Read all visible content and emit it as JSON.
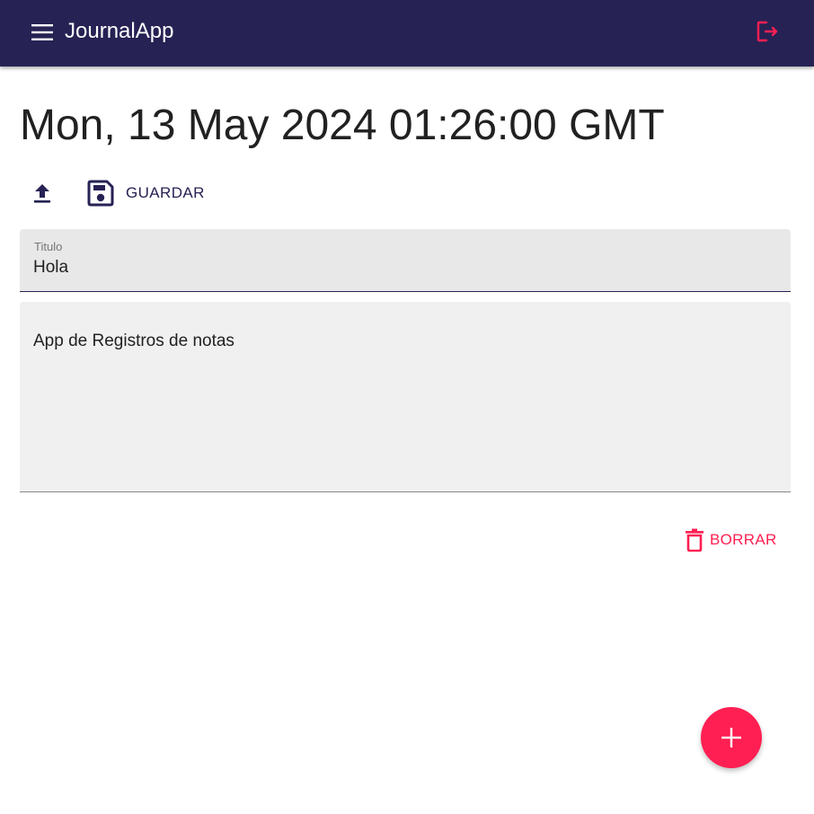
{
  "app": {
    "title": "JournalApp",
    "colors": {
      "primary": "#262254",
      "accent": "#ff1f52",
      "field_bg": "#e8e8e8"
    }
  },
  "header": {
    "menu_icon": "menu-icon",
    "logout_icon": "logout-icon"
  },
  "note": {
    "date": "Mon, 13 May 2024 01:26:00 GMT",
    "toolbar": {
      "upload_icon": "upload-icon",
      "save_icon": "save-icon",
      "save_label": "GUARDAR"
    },
    "title_field": {
      "label": "Titulo",
      "value": "Hola"
    },
    "body_field": {
      "value": "App de Registros de notas"
    },
    "delete": {
      "icon": "trash-icon",
      "label": "BORRAR"
    }
  },
  "fab": {
    "icon": "plus-icon"
  }
}
